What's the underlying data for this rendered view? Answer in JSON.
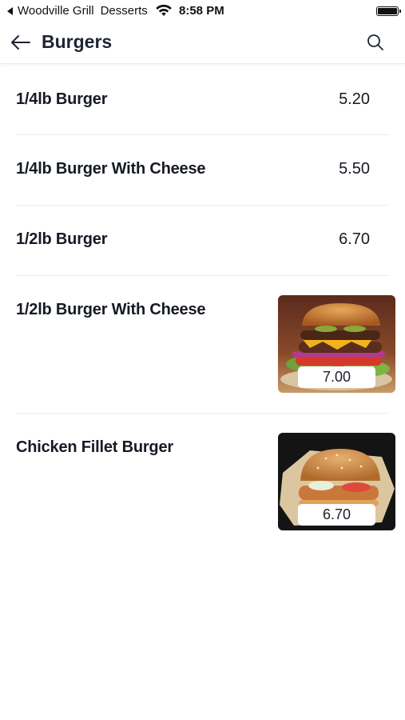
{
  "status_bar": {
    "back_label": "Woodville Grill",
    "app_label": "Desserts",
    "time": "8:58 PM"
  },
  "header": {
    "title": "Burgers",
    "back_icon": "arrow-left-icon",
    "search_icon": "search-icon"
  },
  "menu": {
    "items": [
      {
        "name": "1/4lb Burger",
        "price": "5.20"
      },
      {
        "name": "1/4lb Burger With Cheese",
        "price": "5.50"
      },
      {
        "name": "1/2lb Burger",
        "price": "6.70"
      },
      {
        "name": "1/2lb Burger With Cheese",
        "price": "7.00",
        "image": "cheeseburger-photo"
      },
      {
        "name": "Chicken Fillet Burger",
        "price": "6.70",
        "image": "chicken-burger-photo"
      }
    ]
  }
}
